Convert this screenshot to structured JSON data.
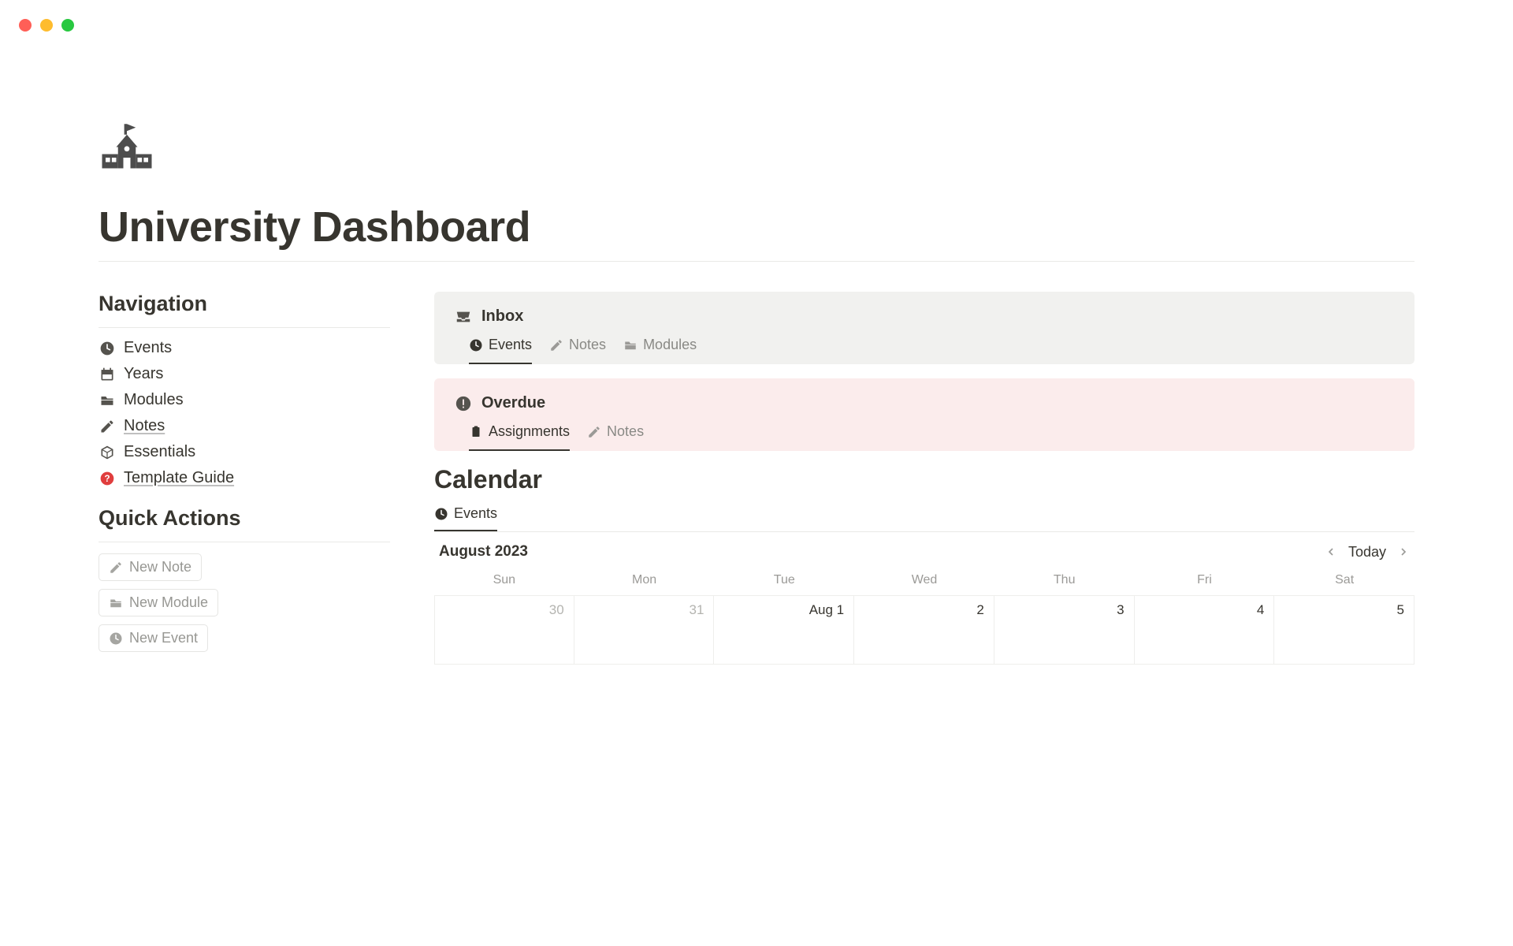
{
  "pageTitle": "University Dashboard",
  "navigationHeading": "Navigation",
  "navItems": [
    {
      "label": "Events",
      "icon": "clock"
    },
    {
      "label": "Years",
      "icon": "calendar"
    },
    {
      "label": "Modules",
      "icon": "folder"
    },
    {
      "label": "Notes",
      "icon": "pencil",
      "underline": true
    },
    {
      "label": "Essentials",
      "icon": "box"
    },
    {
      "label": "Template Guide",
      "icon": "help-red",
      "underline": true
    }
  ],
  "quickActionsHeading": "Quick Actions",
  "quickActions": [
    {
      "label": "New Note",
      "icon": "pencil"
    },
    {
      "label": "New Module",
      "icon": "folder"
    },
    {
      "label": "New Event",
      "icon": "clock"
    }
  ],
  "inbox": {
    "title": "Inbox",
    "tabs": [
      {
        "label": "Events",
        "icon": "clock",
        "active": true
      },
      {
        "label": "Notes",
        "icon": "pencil",
        "active": false
      },
      {
        "label": "Modules",
        "icon": "folder",
        "active": false
      }
    ]
  },
  "overdue": {
    "title": "Overdue",
    "tabs": [
      {
        "label": "Assignments",
        "icon": "clipboard",
        "active": true
      },
      {
        "label": "Notes",
        "icon": "pencil",
        "active": false
      }
    ]
  },
  "calendar": {
    "heading": "Calendar",
    "tabLabel": "Events",
    "monthLabel": "August 2023",
    "todayLabel": "Today",
    "dow": [
      "Sun",
      "Mon",
      "Tue",
      "Wed",
      "Thu",
      "Fri",
      "Sat"
    ],
    "row1": [
      {
        "label": "30",
        "other": true
      },
      {
        "label": "31",
        "other": true
      },
      {
        "label": "Aug 1",
        "other": false
      },
      {
        "label": "2",
        "other": false
      },
      {
        "label": "3",
        "other": false
      },
      {
        "label": "4",
        "other": false
      },
      {
        "label": "5",
        "other": false
      }
    ]
  }
}
